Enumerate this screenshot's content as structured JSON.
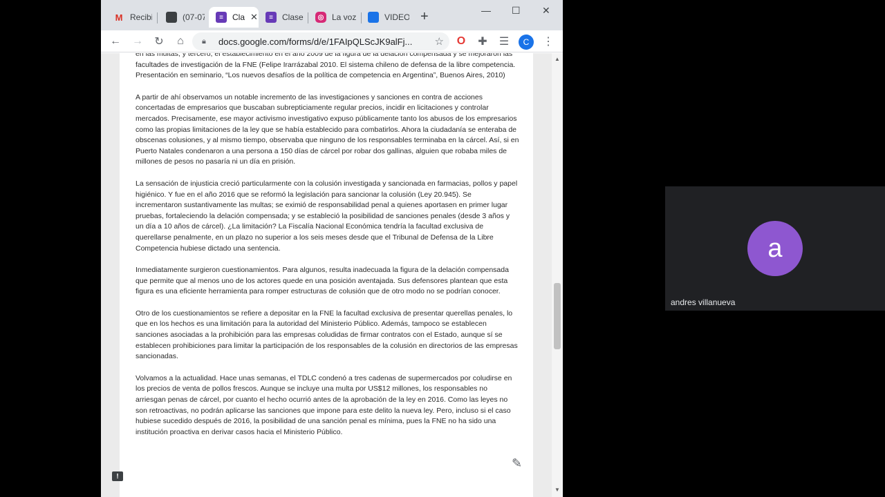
{
  "browser": {
    "tabs": [
      {
        "favicon_letter": "M",
        "favicon_color": "#ffffff",
        "label": "Recibi",
        "active": false
      },
      {
        "favicon_letter": "",
        "favicon_color": "#3c4043",
        "label": "(07-07",
        "active": false
      },
      {
        "favicon_letter": "",
        "favicon_color": "#673ab7",
        "label": "Cla",
        "active": true
      },
      {
        "favicon_letter": "",
        "favicon_color": "#673ab7",
        "label": "Clase",
        "active": false
      },
      {
        "favicon_letter": "",
        "favicon_color": "#d62976",
        "label": "La voz",
        "active": false
      },
      {
        "favicon_letter": "",
        "favicon_color": "#1a73e8",
        "label": "VIDEO",
        "active": false
      }
    ],
    "new_tab_glyph": "+",
    "window_controls": {
      "minimize": "—",
      "maximize": "☐",
      "close": "✕"
    },
    "nav": {
      "back": "←",
      "forward": "→",
      "reload": "↻",
      "home": "⌂"
    },
    "url": "docs.google.com/forms/d/e/1FAIpQLScJK9alFj...",
    "star_glyph": "☆",
    "profile_letter": "C",
    "accent_color": "#1a73e8"
  },
  "document": {
    "paragraphs": [
      "en las multas; y tercero, el establecimiento en el año 2009 de la figura de la delación compensada y se mejoraron las facultades de investigación de la FNE (Felipe Irarrázabal 2010. El sistema chileno de defensa de la libre competencia. Presentación en seminario, “Los nuevos desafíos de la política de competencia en Argentina”, Buenos Aires, 2010)",
      "A partir de ahí observamos un notable incremento de las investigaciones y sanciones en contra de acciones concertadas de empresarios que buscaban subrepticiamente regular precios, incidir en licitaciones y controlar mercados. Precisamente, ese mayor activismo investigativo expuso públicamente tanto los abusos de los empresarios como las propias limitaciones de la ley que se había establecido para combatirlos. Ahora la ciudadanía se enteraba de obscenas colusiones, y al mismo tiempo, observaba que ninguno de los responsables terminaba en la cárcel. Así, si en Puerto Natales condenaron a una persona a 150 días de cárcel por robar dos gallinas, alguien que robaba miles de millones de pesos no pasaría ni un día en prisión.",
      "La sensación de injusticia creció particularmente con la colusión investigada y sancionada en farmacias, pollos y papel higiénico. Y fue en el año 2016 que se reformó la legislación para sancionar la colusión (Ley 20.945). Se incrementaron sustantivamente las multas; se eximió de responsabilidad penal a quienes aportasen en primer lugar pruebas, fortaleciendo la delación compensada; y se estableció la posibilidad de sanciones penales (desde 3 años y un día a 10 años de cárcel). ¿La limitación? La Fiscalía Nacional Económica tendría la facultad exclusiva de querellarse penalmente, en un plazo no superior a los seis meses desde que el Tribunal de Defensa de la Libre Competencia hubiese dictado una sentencia.",
      "Inmediatamente surgieron cuestionamientos. Para algunos, resulta inadecuada la figura de la delación compensada que permite que al menos uno de los actores quede en una posición aventajada. Sus defensores plantean que esta figura es una eficiente herramienta para romper estructuras de colusión que de otro modo no se podrían conocer.",
      "Otro de los cuestionamientos se refiere a depositar en la FNE la facultad exclusiva de presentar querellas penales, lo que en los hechos es una limitación para la autoridad del Ministerio Público. Además, tampoco se establecen sanciones asociadas a la prohibición para las empresas coludidas de firmar contratos con el Estado, aunque sí se establecen prohibiciones para limitar la participación de los responsables de la colusión en directorios de las empresas sancionadas.",
      "Volvamos a la actualidad. Hace unas semanas, el TDLC condenó a tres cadenas de supermercados por coludirse en los precios de venta de pollos frescos. Aunque se incluye una multa por US$12 millones, los responsables no arriesgan penas de cárcel, por cuanto el hecho ocurrió antes de la aprobación de la ley en 2016. Como las leyes no son retroactivas, no podrán aplicarse las sanciones que impone para este delito la nueva ley. Pero, incluso si el caso hubiese sucedido después de 2016, la posibilidad de una sanción penal es mínima, pues la FNE no ha sido una institución proactiva en derivar casos hacia el Ministerio Público."
    ]
  },
  "call": {
    "participant_initial": "a",
    "participant_name": "andres villanueva",
    "avatar_color": "#8e57d0"
  }
}
